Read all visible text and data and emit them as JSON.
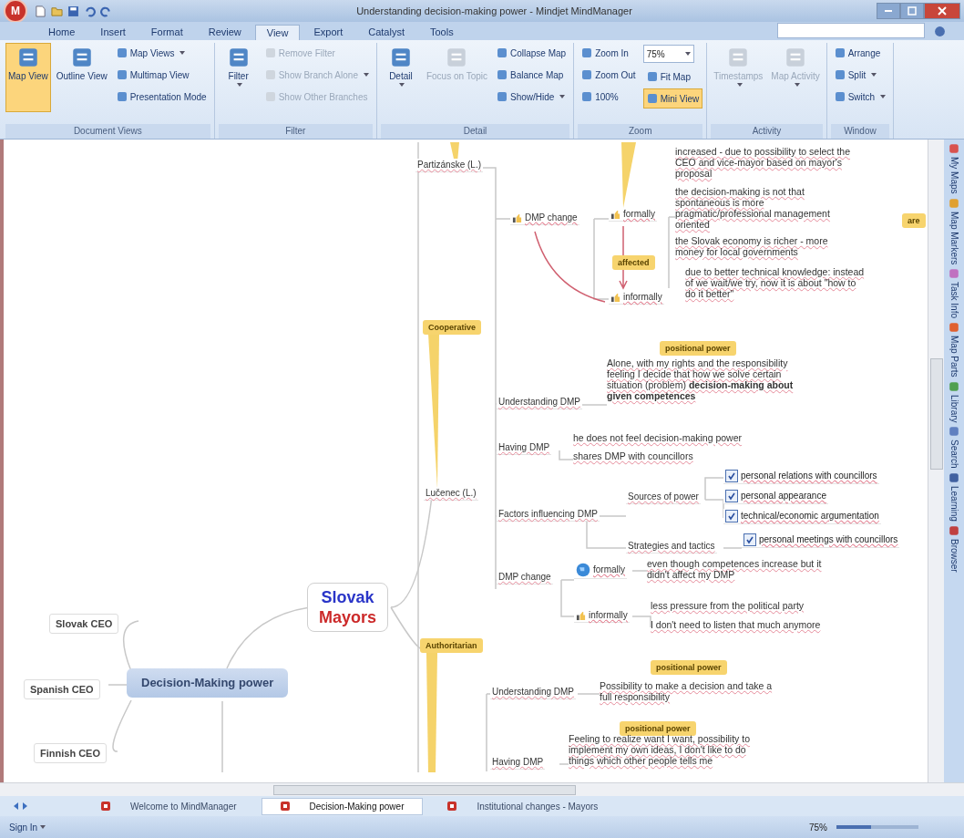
{
  "window": {
    "title": "Understanding decision-making power - Mindjet MindManager",
    "logo": "M"
  },
  "tabs": [
    {
      "label": "Home",
      "selected": false
    },
    {
      "label": "Insert",
      "selected": false
    },
    {
      "label": "Format",
      "selected": false
    },
    {
      "label": "Review",
      "selected": false
    },
    {
      "label": "View",
      "selected": true
    },
    {
      "label": "Export",
      "selected": false
    },
    {
      "label": "Catalyst",
      "selected": false
    },
    {
      "label": "Tools",
      "selected": false
    }
  ],
  "ribbon": [
    {
      "label": "Document Views",
      "buttons": [
        {
          "label": "Map View",
          "kind": "large",
          "selected": true,
          "disabled": false,
          "dropdown": false
        },
        {
          "label": "Outline View",
          "kind": "large",
          "selected": false,
          "disabled": false,
          "dropdown": false
        },
        {
          "label": "Map Views",
          "kind": "small",
          "selected": false,
          "disabled": false,
          "dropdown": true
        },
        {
          "label": "Multimap View",
          "kind": "small",
          "selected": false,
          "disabled": false,
          "dropdown": false
        },
        {
          "label": "Presentation Mode",
          "kind": "small",
          "selected": false,
          "disabled": false,
          "dropdown": false
        }
      ]
    },
    {
      "label": "Filter",
      "buttons": [
        {
          "label": "Filter",
          "kind": "large",
          "selected": false,
          "disabled": false,
          "dropdown": true
        },
        {
          "label": "Remove Filter",
          "kind": "small",
          "selected": false,
          "disabled": true,
          "dropdown": false
        },
        {
          "label": "Show Branch Alone",
          "kind": "small",
          "selected": false,
          "disabled": true,
          "dropdown": true
        },
        {
          "label": "Show Other Branches",
          "kind": "small",
          "selected": false,
          "disabled": true,
          "dropdown": false
        }
      ]
    },
    {
      "label": "Detail",
      "buttons": [
        {
          "label": "Detail",
          "kind": "large",
          "selected": false,
          "disabled": false,
          "dropdown": true
        },
        {
          "label": "Focus on Topic",
          "kind": "large",
          "selected": false,
          "disabled": true,
          "dropdown": false
        },
        {
          "label": "Collapse Map",
          "kind": "small",
          "selected": false,
          "disabled": false,
          "dropdown": false
        },
        {
          "label": "Balance Map",
          "kind": "small",
          "selected": false,
          "disabled": false,
          "dropdown": false
        },
        {
          "label": "Show/Hide",
          "kind": "small",
          "selected": false,
          "disabled": false,
          "dropdown": true
        }
      ]
    },
    {
      "label": "Zoom",
      "buttons": [
        {
          "label": "Zoom In",
          "kind": "small",
          "selected": false,
          "disabled": false,
          "dropdown": false
        },
        {
          "label": "Zoom Out",
          "kind": "small",
          "selected": false,
          "disabled": false,
          "dropdown": false
        },
        {
          "label": "100%",
          "kind": "small",
          "selected": false,
          "disabled": false,
          "dropdown": false
        },
        {
          "label": "75%",
          "kind": "field",
          "dropdown": true
        },
        {
          "label": "Fit Map",
          "kind": "small",
          "selected": false,
          "disabled": false,
          "dropdown": false
        },
        {
          "label": "Mini View",
          "kind": "small",
          "selected": true,
          "disabled": false,
          "dropdown": false
        }
      ]
    },
    {
      "label": "Activity",
      "buttons": [
        {
          "label": "Timestamps",
          "kind": "large",
          "selected": false,
          "disabled": true,
          "dropdown": true
        },
        {
          "label": "Map Activity",
          "kind": "large",
          "selected": false,
          "disabled": true,
          "dropdown": true
        }
      ]
    },
    {
      "label": "Window",
      "buttons": [
        {
          "label": "Arrange",
          "kind": "small",
          "selected": false,
          "disabled": false,
          "dropdown": false
        },
        {
          "label": "Split",
          "kind": "small",
          "selected": false,
          "disabled": false,
          "dropdown": true
        },
        {
          "label": "Switch",
          "kind": "small",
          "selected": false,
          "disabled": false,
          "dropdown": true
        }
      ]
    }
  ],
  "map": [
    {
      "kind": "topic",
      "text": "Partizánske (L.)"
    },
    {
      "kind": "thumb",
      "text": "DMP change"
    },
    {
      "kind": "thumb",
      "text": "formally"
    },
    {
      "kind": "callout",
      "text": "affected"
    },
    {
      "kind": "thumb",
      "text": "informally"
    },
    {
      "kind": "note",
      "text": "increased - due to possibility to select the CEO and vice-mayor based on mayor's proposal"
    },
    {
      "kind": "note",
      "text": "the decision-making is not that spontaneous is more pragmatic/professional management oriented"
    },
    {
      "kind": "note",
      "text": "the Slovak economy is richer - more money for local governments"
    },
    {
      "kind": "note",
      "text": "due to better technical knowledge: instead of we wait/we try, now it is about \"how to do it better\""
    },
    {
      "kind": "callout",
      "text": "are"
    },
    {
      "kind": "callout",
      "text": "Cooperative"
    },
    {
      "kind": "callout",
      "text": "positional power"
    },
    {
      "kind": "topic",
      "text": "Understanding DMP"
    },
    {
      "kind": "note",
      "text": "Alone, with my rights and the responsibility feeling I decide that how we solve certain situation (problem) **decision-making about given competences**"
    },
    {
      "kind": "topic",
      "text": "Having DMP"
    },
    {
      "kind": "note",
      "text": "he does not feel decision-making power"
    },
    {
      "kind": "note",
      "text": "shares DMP with councillors"
    },
    {
      "kind": "topic",
      "text": "Lučenec (L.)"
    },
    {
      "kind": "topic",
      "text": "Factors influencing DMP"
    },
    {
      "kind": "topic",
      "text": "Sources of power"
    },
    {
      "kind": "check",
      "text": "personal relations with councillors",
      "checked": true
    },
    {
      "kind": "check",
      "text": "personal appearance",
      "checked": true
    },
    {
      "kind": "check",
      "text": "technical/economic argumentation",
      "checked": true
    },
    {
      "kind": "topic",
      "text": "Strategies and tactics"
    },
    {
      "kind": "check",
      "text": "personal meetings with councillors",
      "checked": true
    },
    {
      "kind": "topic",
      "text": "DMP change"
    },
    {
      "kind": "globe",
      "text": "formally"
    },
    {
      "kind": "thumb",
      "text": "informally"
    },
    {
      "kind": "note",
      "text": "even though competences increase but it didn't affect my DMP"
    },
    {
      "kind": "note",
      "text": "less pressure from the political party"
    },
    {
      "kind": "note",
      "text": "I don't need to listen that much anymore"
    },
    {
      "kind": "callout",
      "text": "Authoritarian"
    },
    {
      "kind": "callout",
      "text": "positional power"
    },
    {
      "kind": "topic",
      "text": "Understanding DMP"
    },
    {
      "kind": "note",
      "text": "Possibility to make a decision and take a full responsibility"
    },
    {
      "kind": "callout",
      "text": "positional power"
    },
    {
      "kind": "topic",
      "text": "Having DMP"
    },
    {
      "kind": "note",
      "text": "Feeling to realize want I want, possibility to implement my own ideas, I don't like to do things which other people tells me"
    },
    {
      "kind": "main",
      "lines": [
        {
          "text": "Slovak",
          "color": "#2a35c8"
        },
        {
          "text": "Mayors",
          "color": "#cc2a2a"
        }
      ]
    },
    {
      "kind": "central",
      "text": "Decision-Making power"
    },
    {
      "kind": "side",
      "text": "Slovak CEO"
    },
    {
      "kind": "side",
      "text": "Spanish CEO"
    },
    {
      "kind": "side",
      "text": "Finnish CEO"
    }
  ],
  "doc_tabs": [
    {
      "label": "Welcome to MindManager",
      "selected": false
    },
    {
      "label": "Decision-Making power",
      "selected": true
    },
    {
      "label": "Institutional changes - Mayors",
      "selected": false
    }
  ],
  "side_panel": [
    "My Maps",
    "Map Markers",
    "Task Info",
    "Map Parts",
    "Library",
    "Search",
    "Learning",
    "Browser"
  ],
  "status_bar": {
    "sign_in": "Sign In",
    "zoom": "75%",
    "zoom_slider": {
      "level": 0.42
    }
  }
}
